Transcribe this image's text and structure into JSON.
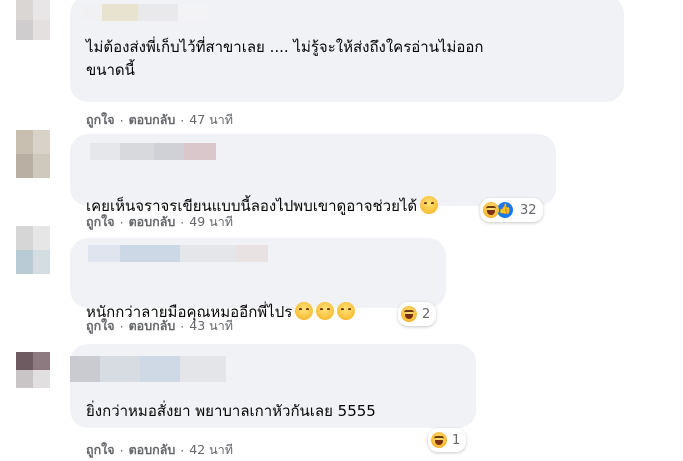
{
  "comments": [
    {
      "text": "ไม่ต้องส่งพี่เก็บไว้ที่สาขาเลย .... ไม่รู้จะให้ส่งถึงใครอ่านไม่ออก\nขนาดนี้",
      "emoji_count": 0,
      "reactions": null,
      "like_label": "ถูกใจ",
      "reply_label": "ตอบกลับ",
      "timestamp": "47 นาที",
      "avatar_colors": [
        "#d9d6d4",
        "#e8e6e6",
        "#cfcdcd",
        "#e3e0df"
      ],
      "name_colors": [
        "#f1f1f3",
        "#e8e3cf",
        "#e9e9ec",
        "#f3f3f5"
      ]
    },
    {
      "text": "เคยเห็นจราจรเขียนแบบนี้ลองไปพบเขาดูอาจช่วยได้",
      "emoji_count": 1,
      "reactions": {
        "count": "32",
        "icons": [
          "laugh-icon",
          "like-icon"
        ]
      },
      "like_label": "ถูกใจ",
      "reply_label": "ตอบกลับ",
      "timestamp": "49 นาที",
      "avatar_colors": [
        "#c9bfb1",
        "#d8d2c8",
        "#b9b0a3",
        "#cfc8bd"
      ],
      "name_colors": [
        "#e6e7ea",
        "#d7d9dd",
        "#cfd1d6",
        "#d9c7cb"
      ]
    },
    {
      "text": "หนักกว่าลายมือคุณหมออีกพี่ไปร",
      "emoji_count": 3,
      "reactions": {
        "count": "2",
        "icons": [
          "laugh-icon"
        ]
      },
      "like_label": "ถูกใจ",
      "reply_label": "ตอบกลับ",
      "timestamp": "43 นาที",
      "avatar_colors": [
        "#d6d6d6",
        "#e6e6e6",
        "#b9ccd6",
        "#d3dde2"
      ],
      "name_colors": [
        "#dfe4ee",
        "#cdd8e6",
        "#e4e6ea",
        "#e9e2e2"
      ]
    },
    {
      "text": "ยิ่งกว่าหมอสั่งยา พยาบาลเกาหัวกันเลย 5555",
      "emoji_count": 0,
      "reactions": {
        "count": "1",
        "icons": [
          "laugh-icon"
        ]
      },
      "like_label": "ถูกใจ",
      "reply_label": "ตอบกลับ",
      "timestamp": "42 นาที",
      "avatar_colors": [
        "#6e5a61",
        "#8c7a80",
        "#c9c4c6",
        "#e2dfe0"
      ],
      "name_colors": [
        "#c9cbd0",
        "#d7dbe2",
        "#cfd9e6",
        "#e4e5e8"
      ]
    }
  ]
}
